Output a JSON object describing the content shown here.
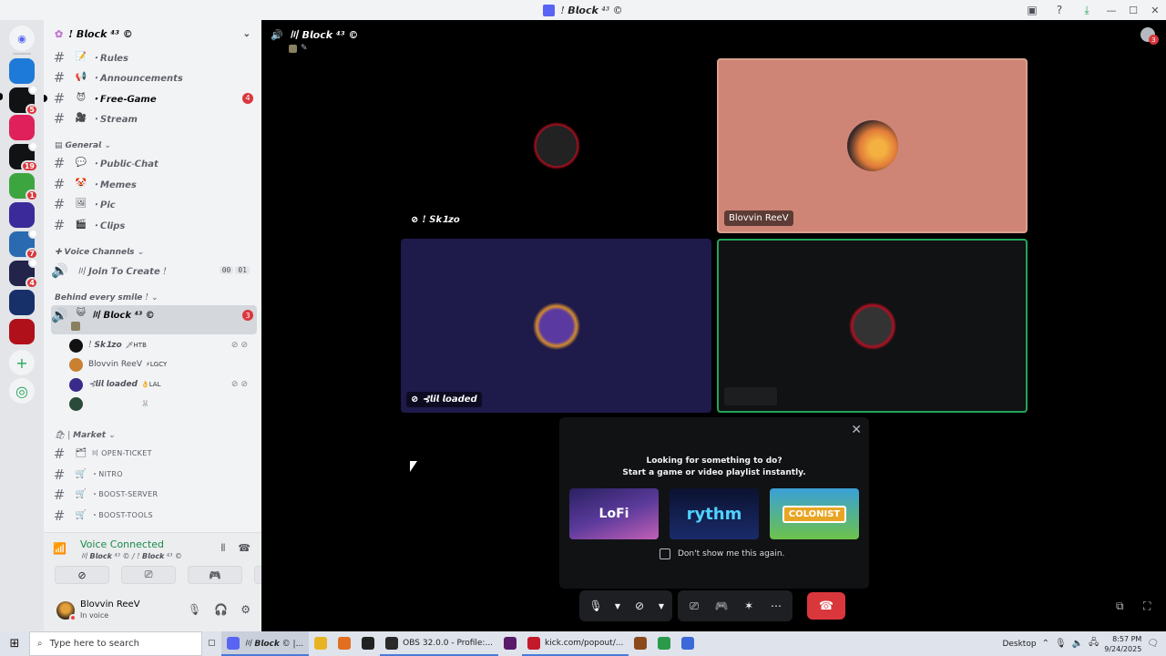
{
  "window": {
    "title": "! 𝘽𝙡𝙤𝙘𝙠 ⁴³ ©",
    "controls": [
      "—",
      "☐",
      "✕"
    ]
  },
  "rail": {
    "servers": [
      {
        "name": "server-1",
        "color": "#1e7ad8",
        "badge": ""
      },
      {
        "name": "server-2",
        "color": "#111214",
        "badge": "5"
      },
      {
        "name": "server-3",
        "color": "#e0205a",
        "badge": ""
      },
      {
        "name": "server-4",
        "color": "#111214",
        "badge": "19"
      },
      {
        "name": "server-5",
        "color": "#3da540",
        "badge": "1"
      },
      {
        "name": "server-6",
        "color": "#3a2a9a",
        "badge": ""
      },
      {
        "name": "server-7",
        "color": "#2a6ab0",
        "badge": "7"
      },
      {
        "name": "server-8",
        "color": "#22244a",
        "badge": "4"
      },
      {
        "name": "server-9",
        "color": "#18306a",
        "badge": ""
      },
      {
        "name": "server-10",
        "color": "#b0101a",
        "badge": ""
      }
    ]
  },
  "sidebar": {
    "guild_name": "! 𝘽𝙡𝙤𝙘𝙠 ⁴³ ©",
    "channels_top": [
      {
        "label": "・𝙍𝙪𝙡𝙚𝙨",
        "emoji": "📝",
        "count": ""
      },
      {
        "label": "・𝘼𝙣𝙣𝙤𝙪𝙣𝙘𝙚𝙢𝙚𝙣𝙩𝙨",
        "emoji": "📢",
        "count": ""
      },
      {
        "label": "・𝙁𝙧𝙚𝙚-𝙂𝙖𝙢𝙚",
        "emoji": "😈",
        "count": "4"
      },
      {
        "label": "・𝙎𝙩𝙧𝙚𝙖𝙢",
        "emoji": "🎥",
        "count": ""
      }
    ],
    "category_general": "𝙂𝙚𝙣𝙚𝙧𝙖𝙡",
    "channels_general": [
      {
        "label": "・𝙋𝙪𝙗𝙡𝙞𝙘-𝘾𝙝𝙖𝙩",
        "emoji": "💬"
      },
      {
        "label": "・𝙈𝙚𝙢𝙚𝙨",
        "emoji": "🤡"
      },
      {
        "label": "・𝙋𝙞𝙘",
        "emoji": "🖼"
      },
      {
        "label": "・𝘾𝙡𝙞𝙥𝙨",
        "emoji": "🎬"
      }
    ],
    "category_voice": "𝙑𝙤𝙞𝙘𝙚 𝘾𝙝𝙖𝙣𝙣𝙚𝙡𝙨",
    "join_to_create": {
      "label": "〣 𝙅𝙤𝙞𝙣 𝙏𝙤 𝘾𝙧𝙚𝙖𝙩𝙚 !",
      "users": "00",
      "limit": "01"
    },
    "category_behind": "𝘽𝙚𝙝𝙞𝙣𝙙 𝙚𝙫𝙚𝙧𝙮 𝙨𝙢𝙞𝙡𝙚 !",
    "active_voice": {
      "label": "〣 𝘽𝙡𝙤𝙘𝙠 ⁴³ ©",
      "count": "3"
    },
    "voice_users": [
      {
        "name": "! 𝙎𝙠𝟭𝙯𝙤",
        "tag": "🗡HTB",
        "color": "#111"
      },
      {
        "name": "Blovvin ReeV",
        "tag": "⚡LGCY",
        "color": "#c98030"
      },
      {
        "name": "⊰𝙡𝙞𝙡 𝙡𝙤𝙖𝙙𝙚𝙙",
        "tag": "👌LAL",
        "color": "#3a2a8a"
      },
      {
        "name": "",
        "tag": "🐰",
        "color": "#2a4a3a"
      }
    ],
    "category_market": "🛍 | 𝙈𝙖𝙧𝙠𝙚𝙩",
    "channels_market": [
      {
        "label": "〣 OPEN-TICKET",
        "emoji": "🗂"
      },
      {
        "label": "・NITRO",
        "emoji": "🛒"
      },
      {
        "label": "・BOOST-SERVER",
        "emoji": "🛒"
      },
      {
        "label": "・BOOST-TOOLS",
        "emoji": "🛒"
      }
    ]
  },
  "voice_panel": {
    "title": "Voice Connected",
    "subtitle": "〣 𝘽𝙡𝙤𝙘𝙠 ⁴³ © / ! 𝘽𝙡𝙤𝙘𝙠 ⁴³ ©"
  },
  "user_panel": {
    "name": "Blovvin ReeV",
    "state": "In voice"
  },
  "stage": {
    "header": "〣 𝘽𝙡𝙤𝙘𝙠 ⁴³ ©",
    "inbox_badge": "3",
    "tiles": [
      {
        "name": "! 𝙎𝙠𝟭𝙯𝙤",
        "bg": "#000000"
      },
      {
        "name": "Blovvin ReeV",
        "bg": "#cf8576"
      },
      {
        "name": "⊰𝙡𝙞𝙡 𝙡𝙤𝙖𝙙𝙚𝙙",
        "bg": "#1e1a4a"
      },
      {
        "name": "",
        "bg": "#111214"
      }
    ]
  },
  "popup": {
    "line1": "Looking for something to do?",
    "line2": "Start a game or video playlist instantly.",
    "cards": [
      "LoFi",
      "rythm",
      "COLONIST"
    ],
    "checkbox_label": "Don't show me this again."
  },
  "taskbar": {
    "search_placeholder": "Type here to search",
    "apps": [
      {
        "label": "〣 𝘽𝙡𝙤𝙘𝙠 © |...",
        "color": "#5865f2"
      },
      {
        "label": "",
        "color": "#e6b422"
      },
      {
        "label": "",
        "color": "#e07020"
      },
      {
        "label": "",
        "color": "#222"
      },
      {
        "label": "OBS 32.0.0 - Profile:...",
        "color": "#2a2a2a"
      },
      {
        "label": "",
        "color": "#5a1a6a"
      },
      {
        "label": "kick.com/popout/...",
        "color": "#c21a2a"
      },
      {
        "label": "",
        "color": "#8a4a1a"
      },
      {
        "label": "",
        "color": "#2a9a4a"
      },
      {
        "label": "",
        "color": "#3a6ad8"
      }
    ],
    "desktop_label": "Desktop",
    "time": "8:57 PM",
    "date": "9/24/2025"
  }
}
